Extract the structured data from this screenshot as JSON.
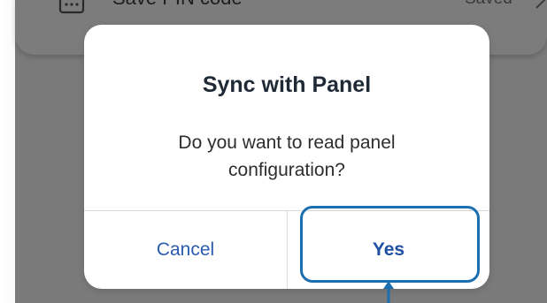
{
  "background_row": {
    "label": "Save PIN code",
    "status": "Saved",
    "icon": "lock-icon",
    "chevron": "chevron-right-icon"
  },
  "dialog": {
    "title": "Sync with Panel",
    "message": "Do you want to read panel configuration?",
    "cancel_label": "Cancel",
    "confirm_label": "Yes"
  },
  "colors": {
    "overlay": "#7a7a7a",
    "dialog_bg": "#ffffff",
    "button_text": "#2a5bb0",
    "highlight": "#1b6fb0"
  }
}
